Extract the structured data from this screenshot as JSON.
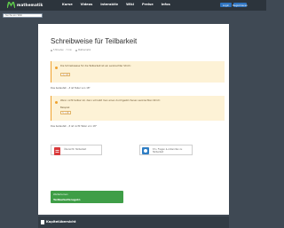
{
  "brand": {
    "name": "mathematik",
    "logo_color": "#5cc34a"
  },
  "nav": {
    "items": [
      "Kurse",
      "Videos",
      "Interaktiv",
      "Wiki",
      "Preise",
      "Infos"
    ]
  },
  "auth": {
    "login": "Login",
    "register": "Registrieren"
  },
  "search": {
    "placeholder": "Suche ein Wiki"
  },
  "page": {
    "title": "Schreibweise für Teilbarkeit",
    "meta_date": "5 Minuten · 7 min",
    "meta_author": "Mathematik"
  },
  "hints": [
    {
      "text": "Die Schreibweise für die Teilbarkeit ist ein senkrechter Strich:",
      "example": "3 | 18"
    },
    {
      "text": "Wenn nicht teilbar ist, dann schreibt man einen durchgestrichenen senkrechten Strich:",
      "extra": "Beispiel:",
      "example": "5 ∤ 18"
    }
  ],
  "captions": [
    "Das bedeutet: „3 ist Teiler von 18\"",
    "Das bedeutet: „5 ist nicht Teiler von 18\""
  ],
  "resources": [
    {
      "label": "Übersicht: Teilbarkeit",
      "icon": "pdf-icon",
      "color": "#d9393b"
    },
    {
      "label": "67+ Fragen & Antworten zu Teilbarkeit",
      "icon": "quiz-icon",
      "color": "#2f7ec4"
    }
  ],
  "cta": {
    "line1": "Weiterlernen",
    "line2": "Teilbarkeitsregeln"
  },
  "chapter": {
    "title": "Kapitelübersicht"
  }
}
